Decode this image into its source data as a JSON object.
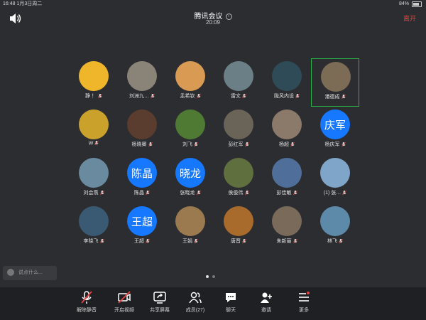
{
  "status": {
    "time": "16:48",
    "date": "1月3日周二",
    "battery": "84%"
  },
  "header": {
    "title": "腾讯会议",
    "timer": "20:09",
    "leave_label": "离开"
  },
  "participants": [
    {
      "name": "静 ！",
      "avatar_text": "",
      "color": "#f0b62b",
      "active": false
    },
    {
      "name": "刘洲九…",
      "avatar_text": "",
      "color": "#8a8378",
      "active": false
    },
    {
      "name": "孟希钦",
      "avatar_text": "",
      "color": "#d99a54",
      "active": false
    },
    {
      "name": "雷文",
      "avatar_text": "",
      "color": "#6a7f86",
      "active": false
    },
    {
      "name": "陇风内设",
      "avatar_text": "",
      "color": "#2f4b57",
      "active": false
    },
    {
      "name": "潘德成",
      "avatar_text": "",
      "color": "#7c6b55",
      "active": true
    },
    {
      "name": "W",
      "avatar_text": "",
      "color": "#c9a12b",
      "active": false
    },
    {
      "name": "杨晓卿",
      "avatar_text": "",
      "color": "#5a3d2e",
      "active": false
    },
    {
      "name": "刘飞",
      "avatar_text": "",
      "color": "#4f7a34",
      "active": false
    },
    {
      "name": "彭红军",
      "avatar_text": "",
      "color": "#6a6357",
      "active": false
    },
    {
      "name": "杨超",
      "avatar_text": "",
      "color": "#8b7a6a",
      "active": false
    },
    {
      "name": "杨庆军",
      "avatar_text": "庆军",
      "color": "#1677ff",
      "active": false
    },
    {
      "name": "刘会燕",
      "avatar_text": "",
      "color": "#6a8aa0",
      "active": false
    },
    {
      "name": "陈晶",
      "avatar_text": "陈晶",
      "color": "#1677ff",
      "active": false
    },
    {
      "name": "张晓龙",
      "avatar_text": "晓龙",
      "color": "#1677ff",
      "active": false
    },
    {
      "name": "侯俊伟",
      "avatar_text": "",
      "color": "#5f6f3e",
      "active": false
    },
    {
      "name": "彭佳敏",
      "avatar_text": "",
      "color": "#4f6f9a",
      "active": false
    },
    {
      "name": "(1) 张…",
      "avatar_text": "",
      "color": "#7fa6c9",
      "active": false
    },
    {
      "name": "李晓飞",
      "avatar_text": "",
      "color": "#3a5a74",
      "active": false
    },
    {
      "name": "王超",
      "avatar_text": "王超",
      "color": "#1677ff",
      "active": false
    },
    {
      "name": "王娟",
      "avatar_text": "",
      "color": "#9a7a4e",
      "active": false
    },
    {
      "name": "唐晋",
      "avatar_text": "",
      "color": "#a86b2b",
      "active": false
    },
    {
      "name": "朱新丽",
      "avatar_text": "",
      "color": "#7a6a5a",
      "active": false
    },
    {
      "name": "林飞",
      "avatar_text": "",
      "color": "#5d8aa8",
      "active": false
    }
  ],
  "chat": {
    "placeholder": "说点什么..."
  },
  "toolbar": [
    {
      "label": "解除静音",
      "icon": "mic-muted-icon"
    },
    {
      "label": "开启视频",
      "icon": "video-off-icon"
    },
    {
      "label": "共享屏幕",
      "icon": "share-screen-icon"
    },
    {
      "label": "成员(27)",
      "icon": "members-icon"
    },
    {
      "label": "聊天",
      "icon": "chat-icon"
    },
    {
      "label": "邀请",
      "icon": "invite-icon"
    },
    {
      "label": "更多",
      "icon": "more-icon"
    }
  ]
}
